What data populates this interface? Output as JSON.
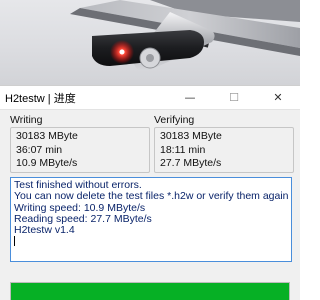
{
  "window": {
    "title": "H2testw | 进度",
    "minimize_icon": "minimize-icon",
    "maximize_icon": "maximize-icon",
    "close_icon": "close-icon"
  },
  "writing": {
    "header": "Writing",
    "size": "30183 MByte",
    "time": "36:07 min",
    "speed": "10.9 MByte/s"
  },
  "verifying": {
    "header": "Verifying",
    "size": "30183 MByte",
    "time": "18:11 min",
    "speed": "27.7 MByte/s"
  },
  "log": {
    "lines": [
      "Test finished without errors.",
      "You can now delete the test files *.h2w or verify them again.",
      "Writing speed: 10.9 MByte/s",
      "Reading speed: 27.7 MByte/s",
      "H2testw v1.4"
    ]
  },
  "progress": {
    "fraction": 1.0,
    "color": "#06b025"
  },
  "colors": {
    "log_border": "#4a8edb",
    "log_text": "#0a246a"
  }
}
